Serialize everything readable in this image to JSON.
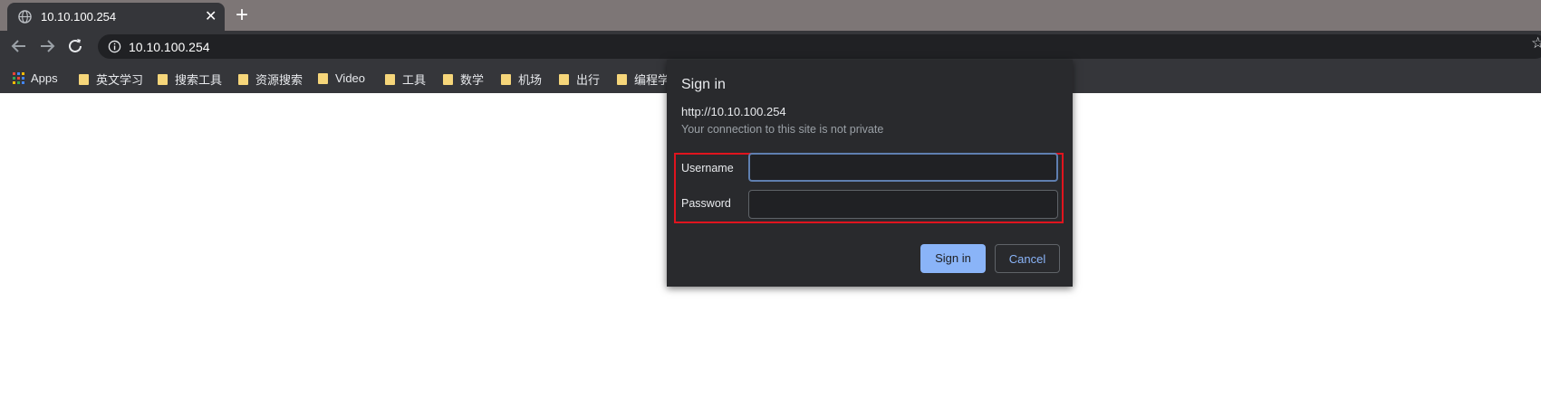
{
  "tab": {
    "title": "10.10.100.254",
    "close_glyph": "✕"
  },
  "new_tab_glyph": "+",
  "toolbar": {
    "url": "10.10.100.254",
    "icons": [
      "back-arrow-icon",
      "forward-arrow-icon",
      "reload-icon",
      "info-icon",
      "star-icon"
    ]
  },
  "bookmarks": [
    {
      "label": "Apps",
      "icon": "apps-grid-icon"
    },
    {
      "label": "英文学习",
      "icon": "folder-icon"
    },
    {
      "label": "搜索工具",
      "icon": "folder-icon"
    },
    {
      "label": "资源搜索",
      "icon": "folder-icon"
    },
    {
      "label": "Video",
      "icon": "folder-icon"
    },
    {
      "label": "工具",
      "icon": "folder-icon"
    },
    {
      "label": "数学",
      "icon": "folder-icon"
    },
    {
      "label": "机场",
      "icon": "folder-icon"
    },
    {
      "label": "出行",
      "icon": "folder-icon"
    },
    {
      "label": "编程学",
      "icon": "folder-icon"
    }
  ],
  "dialog": {
    "title": "Sign in",
    "origin": "http://10.10.100.254",
    "warning": "Your connection to this site is not private",
    "username_label": "Username",
    "username_value": "",
    "password_label": "Password",
    "password_value": "",
    "signin_label": "Sign in",
    "cancel_label": "Cancel"
  },
  "colors": {
    "tabstrip": "#7d7676",
    "toolbar": "#35363a",
    "dialog_bg": "#292a2d",
    "accent": "#8ab4f8",
    "highlight": "#e0141e"
  }
}
